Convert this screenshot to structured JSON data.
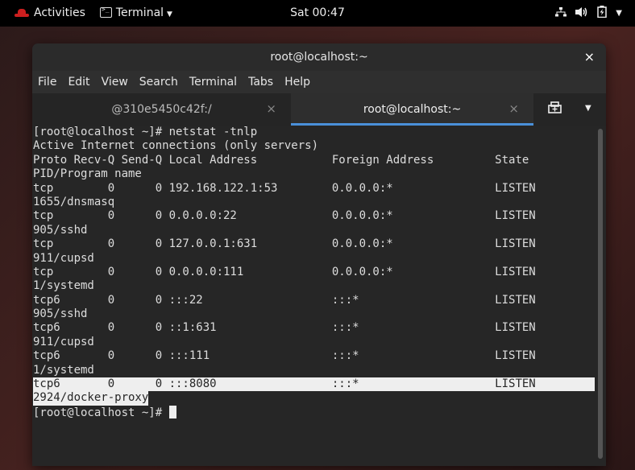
{
  "topbar": {
    "activities": "Activities",
    "app_name": "Terminal",
    "clock": "Sat 00:47",
    "tray_network": "⚲",
    "tray_volume": "🔊",
    "tray_power": "⚡",
    "tray_menu": "▾"
  },
  "window": {
    "title": "root@localhost:~",
    "close": "×",
    "menu": [
      "File",
      "Edit",
      "View",
      "Search",
      "Terminal",
      "Tabs",
      "Help"
    ],
    "tabs": [
      {
        "label": "@310e5450c42f:/",
        "close": "×"
      },
      {
        "label": "root@localhost:~",
        "close": "×"
      }
    ],
    "new_tab": "⊞",
    "tab_menu": "▼"
  },
  "terminal": {
    "lines": [
      "[root@localhost ~]# netstat -tnlp",
      "Active Internet connections (only servers)",
      "Proto Recv-Q Send-Q Local Address           Foreign Address         State",
      "PID/Program name",
      "tcp        0      0 192.168.122.1:53        0.0.0.0:*               LISTEN",
      "1655/dnsmasq",
      "tcp        0      0 0.0.0.0:22              0.0.0.0:*               LISTEN",
      "905/sshd",
      "tcp        0      0 127.0.0.1:631           0.0.0.0:*               LISTEN",
      "911/cupsd",
      "tcp        0      0 0.0.0.0:111             0.0.0.0:*               LISTEN",
      "1/systemd",
      "tcp6       0      0 :::22                   :::*                    LISTEN",
      "905/sshd",
      "tcp6       0      0 ::1:631                 :::*                    LISTEN",
      "911/cupsd",
      "tcp6       0      0 :::111                  :::*                    LISTEN",
      "1/systemd",
      "tcp6       0      0 :::8080                 :::*                    LISTEN",
      "2924/docker-proxy"
    ],
    "prompt": "[root@localhost ~]# "
  }
}
